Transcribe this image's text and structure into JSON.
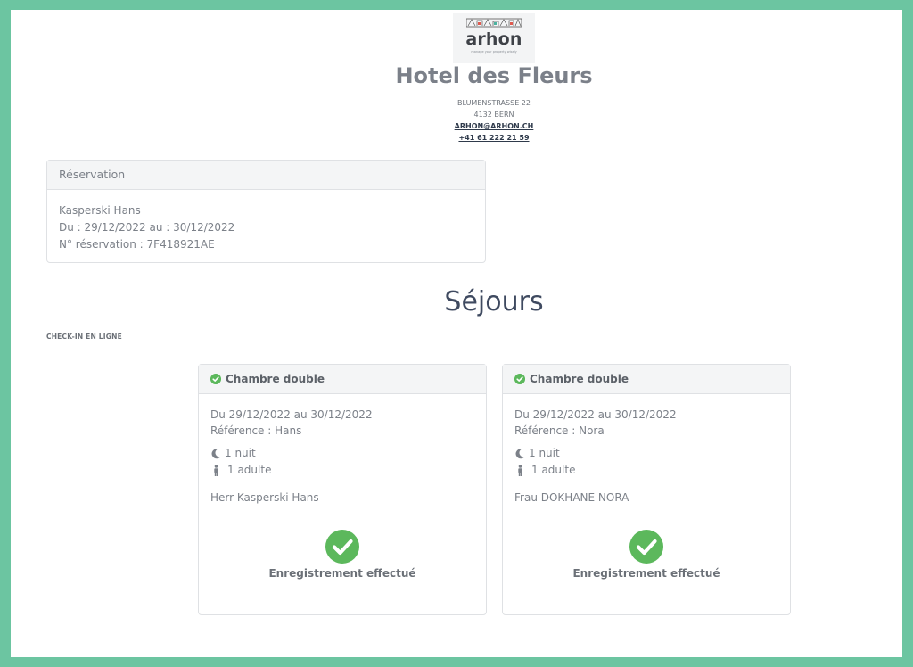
{
  "brand": {
    "logo_word": "arhon",
    "logo_tagline": "manage your property wisely"
  },
  "hotel": {
    "name": "Hotel des Fleurs",
    "street": "BLUMENSTRASSE 22",
    "city": "4132 BERN",
    "email": "ARHON@ARHON.CH",
    "phone": "+41 61 222 21 59"
  },
  "reservation": {
    "header": "Réservation",
    "guest": "Kasperski Hans",
    "dates": "Du : 29/12/2022 au : 30/12/2022",
    "number": "N° réservation : 7F418921AE"
  },
  "stays_title": "Séjours",
  "checkin_label": "CHECK-IN EN LIGNE",
  "rooms": [
    {
      "title": "Chambre double",
      "dates": "Du 29/12/2022 au 30/12/2022",
      "reference": "Référence : Hans",
      "nights": "1 nuit",
      "adults": "1 adulte",
      "guest": "Herr Kasperski Hans",
      "status": "Enregistrement effectué"
    },
    {
      "title": "Chambre double",
      "dates": "Du 29/12/2022 au 30/12/2022",
      "reference": "Référence : Nora",
      "nights": "1 nuit",
      "adults": "1 adulte",
      "guest": "Frau DOKHANE NORA",
      "status": "Enregistrement effectué"
    }
  ],
  "colors": {
    "frame": "#6cc5a1",
    "success": "#5cb85c",
    "title": "#3f4a60"
  }
}
